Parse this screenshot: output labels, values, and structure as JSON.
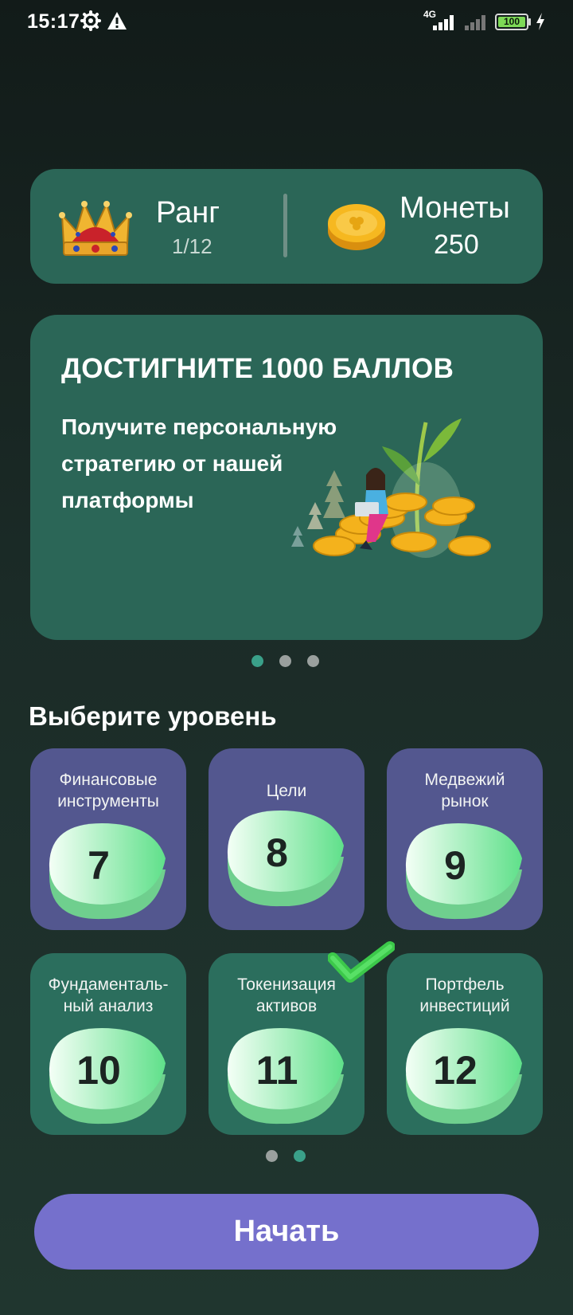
{
  "status_bar": {
    "time": "15:17",
    "network": "4G",
    "battery": "100"
  },
  "stats": {
    "rank_title": "Ранг",
    "rank_value": "1/12",
    "coins_title": "Монеты",
    "coins_value": "250"
  },
  "promo": {
    "title": "ДОСТИГНИТЕ 1000 БАЛЛОВ",
    "text": "Получите персональную стратегию от нашей платформы"
  },
  "section_title": "Выберите уровень",
  "levels": [
    {
      "label": "Финансовые\nинструменты",
      "number": "7",
      "color": "purple"
    },
    {
      "label": "Цели",
      "number": "8",
      "color": "purple"
    },
    {
      "label": "Медвежий\nрынок",
      "number": "9",
      "color": "purple"
    },
    {
      "label": "Фундаменталь-\nный анализ",
      "number": "10",
      "color": "teal"
    },
    {
      "label": "Токенизация\nактивов",
      "number": "11",
      "color": "teal",
      "completed": true
    },
    {
      "label": "Портфель\nинвестиций",
      "number": "12",
      "color": "teal"
    }
  ],
  "start_button": "Начать",
  "colors": {
    "card": "#2b6657",
    "tile_purple": "#53578f",
    "tile_teal": "#2b6e5d",
    "button": "#7570cc",
    "accent": "#3aa089"
  }
}
